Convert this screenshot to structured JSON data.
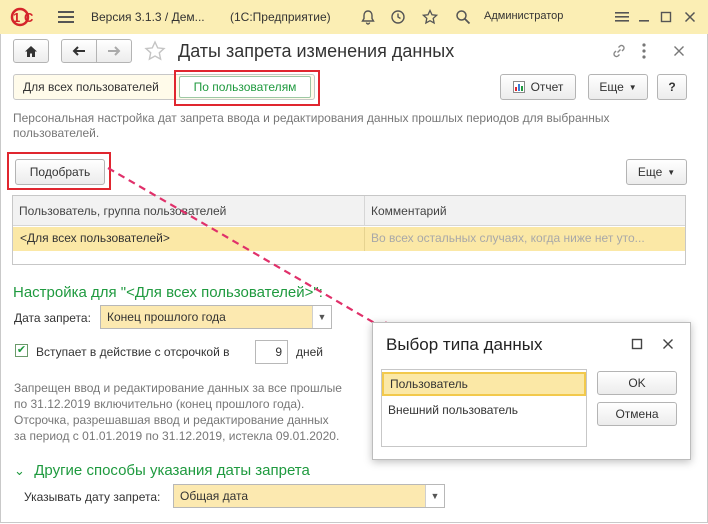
{
  "topbar": {
    "logo": "1С",
    "title": "Версия 3.1.3 / Дем...",
    "app": "(1С:Предприятие)",
    "user": "Администратор",
    "icons": [
      "hamburger-icon",
      "bell-icon",
      "history-icon",
      "star-icon",
      "search-icon",
      "menu-lines-icon",
      "minimize-icon",
      "maximize-icon",
      "close-icon"
    ]
  },
  "window": {
    "title": "Даты запрета изменения данных",
    "tabs": {
      "all_users": "Для всех пользователей",
      "by_users": "По пользователям"
    },
    "report_button": "Отчет",
    "more_button": "Еще",
    "help_button": "?",
    "description": "Персональная настройка дат запрета ввода и редактирования данных прошлых периодов для выбранных пользователей.",
    "pick_button": "Подобрать",
    "table_more_button": "Еще",
    "table": {
      "columns": [
        "Пользователь, группа пользователей",
        "Комментарий"
      ],
      "rows": [
        {
          "user": "<Для всех пользователей>",
          "comment": "Во всех остальных случаях, когда ниже нет уто..."
        }
      ]
    },
    "settings_header": "Настройка для \"<Для всех пользователей>\":",
    "date_label": "Дата запрета:",
    "date_value": "Конец прошлого года",
    "delay_label": "Вступает в действие с отсрочкой в",
    "delay_value": "9",
    "delay_unit": "дней",
    "info_text": [
      "Запрещен ввод и редактирование данных за все прошлые",
      "по 31.12.2019 включительно (конец прошлого года).",
      "Отсрочка, разрешавшая ввод и редактирование данных",
      "за период с 01.01.2019 по 31.12.2019, истекла 09.01.2020."
    ],
    "other_ways_header": "Другие способы указания даты запрета",
    "specify_label": "Указывать дату запрета:",
    "specify_value": "Общая дата"
  },
  "popup": {
    "title": "Выбор типа данных",
    "items": [
      "Пользователь",
      "Внешний пользователь"
    ],
    "ok_button": "OK",
    "cancel_button": "Отмена"
  },
  "colors": {
    "topbar_bg": "#fbeeb4",
    "accent_green": "#1f9a3f",
    "selection": "#fbe8a6",
    "highlight_red": "#e0262f",
    "arrow_pink": "#e0306a"
  }
}
